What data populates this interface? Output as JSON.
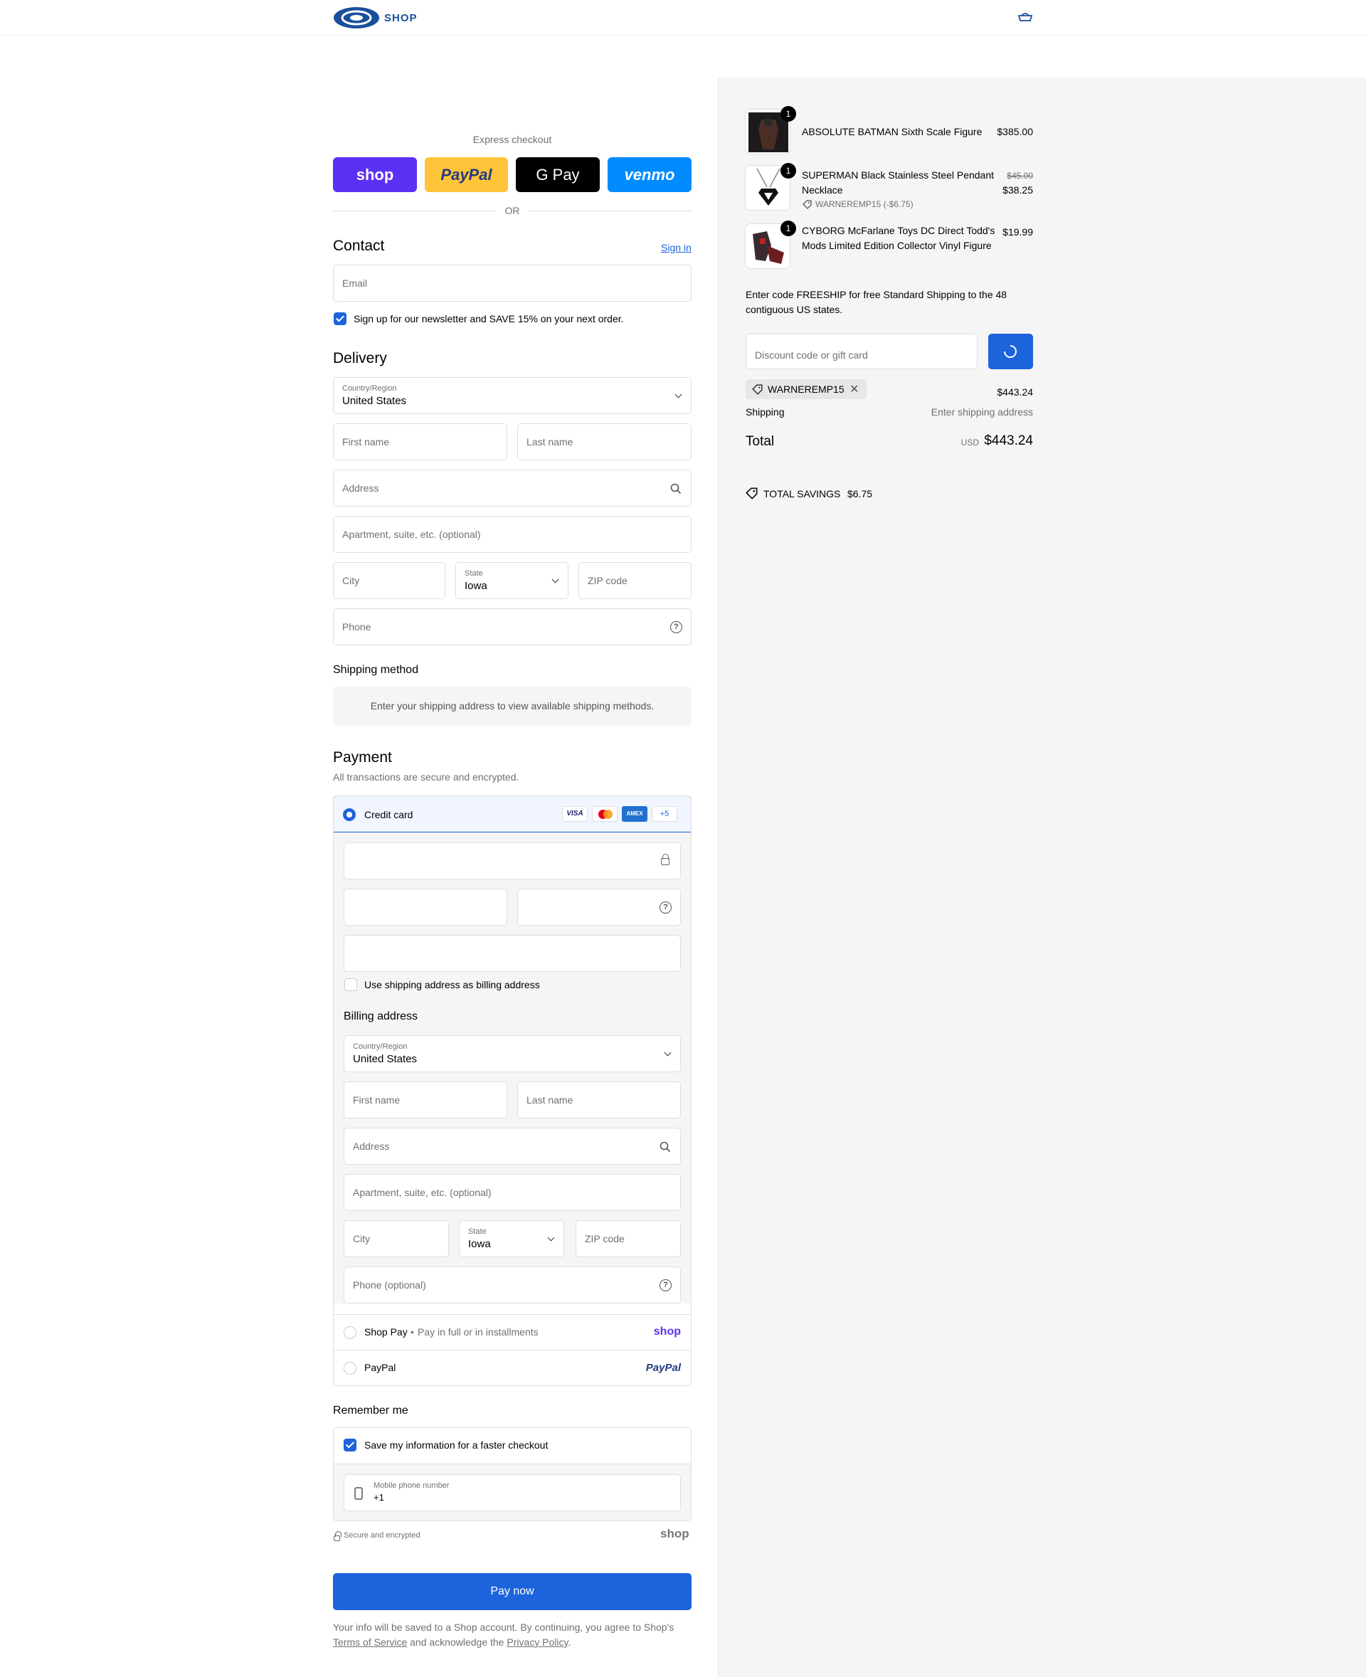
{
  "brand": {
    "name": "SHOP",
    "icon": "shop-logo-icon",
    "color": "#1a4f9c"
  },
  "header": {
    "cart_icon": "cart-icon"
  },
  "express": {
    "title": "Express checkout",
    "or": "OR",
    "buttons": [
      {
        "label": "shop",
        "color": "#5a31f4"
      },
      {
        "label": "PayPal",
        "color": "#ffc439"
      },
      {
        "label": "G Pay",
        "color": "#000000"
      },
      {
        "label": "venmo",
        "color": "#008cff"
      }
    ]
  },
  "contact": {
    "heading": "Contact",
    "sign_in": "Sign in",
    "email_placeholder": "Email",
    "newsletter_label": "Sign up for our newsletter and SAVE 15% on your next order.",
    "newsletter_checked": true
  },
  "delivery": {
    "heading": "Delivery",
    "country_label": "Country/Region",
    "country_value": "United States",
    "first_name": "First name",
    "last_name": "Last name",
    "address": "Address",
    "apartment": "Apartment, suite, etc. (optional)",
    "city": "City",
    "state_label": "State",
    "state_value": "Iowa",
    "zip": "ZIP code",
    "phone": "Phone"
  },
  "shipping_method": {
    "heading": "Shipping method",
    "message": "Enter your shipping address to view available shipping methods."
  },
  "payment": {
    "heading": "Payment",
    "subtitle": "All transactions are secure and encrypted.",
    "credit_card": {
      "label": "Credit card",
      "selected": true,
      "cards": [
        "VISA",
        "mastercard",
        "AMEX",
        "+5"
      ],
      "billing_checkbox": "Use shipping address as billing address"
    },
    "billing": {
      "heading": "Billing address",
      "country_label": "Country/Region",
      "country_value": "United States",
      "first_name": "First name",
      "last_name": "Last name",
      "address": "Address",
      "apartment": "Apartment, suite, etc. (optional)",
      "city": "City",
      "state_label": "State",
      "state_value": "Iowa",
      "zip": "ZIP code",
      "phone": "Phone (optional)"
    },
    "shop_pay": {
      "label": "Shop Pay",
      "sub": "Pay in full or in installments",
      "logo": "shop"
    },
    "paypal": {
      "label": "PayPal",
      "logo": "PayPal"
    }
  },
  "remember": {
    "heading": "Remember me",
    "save_label": "Save my information for a faster checkout",
    "save_checked": true,
    "mobile_label": "Mobile phone number",
    "mobile_value": "+1",
    "secure": "Secure and encrypted",
    "shop_logo": "shop"
  },
  "pay_now": "Pay now",
  "footer": {
    "pre": "Your info will be saved to a Shop account. By continuing, you agree to Shop's",
    "terms": "Terms of Service",
    "mid": "and acknowledge the",
    "privacy": "Privacy Policy",
    "end": "."
  },
  "cart": {
    "items": [
      {
        "qty": "1",
        "title": "ABSOLUTE BATMAN Sixth Scale Figure",
        "price": "$385.00"
      },
      {
        "qty": "1",
        "title": "SUPERMAN Black Stainless Steel Pendant Necklace",
        "original_price": "$45.00",
        "price": "$38.25",
        "discount": "WARNEREMP15 (-$6.75)"
      },
      {
        "qty": "1",
        "title": "CYBORG McFarlane Toys DC Direct Todd's Mods Limited Edition Collector Vinyl Figure",
        "price": "$19.99"
      }
    ],
    "promo": "Enter code FREESHIP for free Standard Shipping to the 48 contiguous US states.",
    "discount_placeholder": "Discount code or gift card",
    "applied_code": "WARNEREMP15",
    "subtotal": "$443.24",
    "shipping_label": "Shipping",
    "shipping_value": "Enter shipping address",
    "total_label": "Total",
    "currency": "USD",
    "total": "$443.24",
    "savings_label": "TOTAL SAVINGS",
    "savings": "$6.75"
  }
}
